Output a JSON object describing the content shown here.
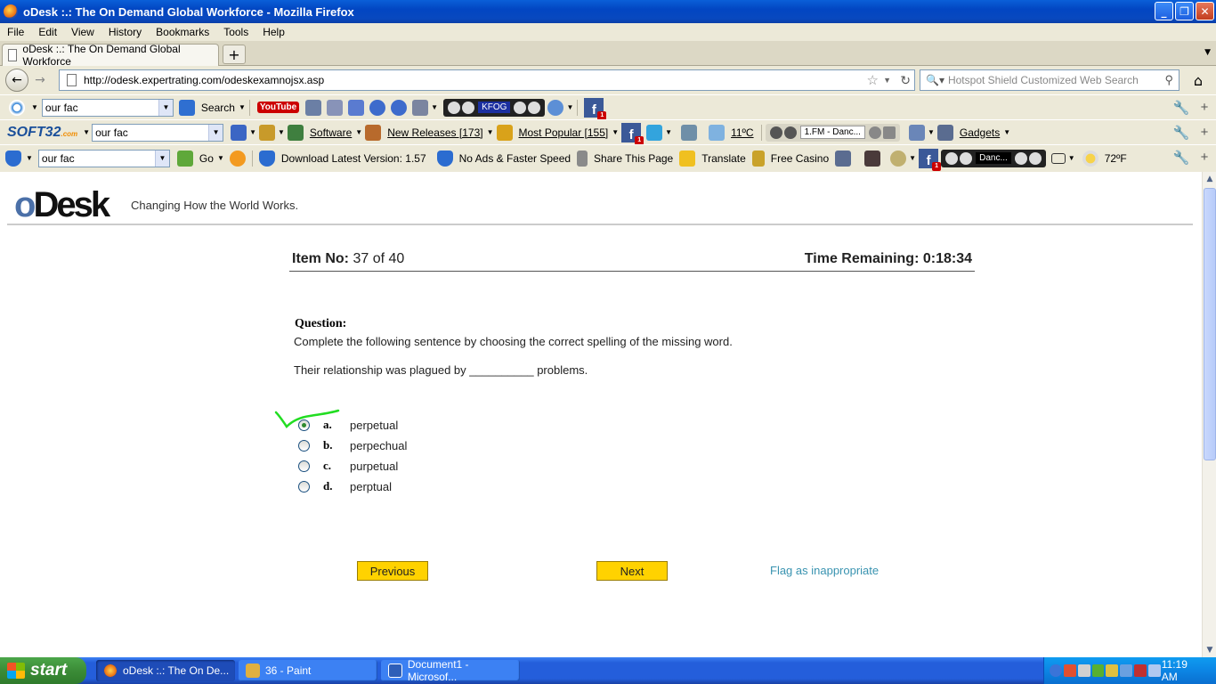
{
  "window": {
    "title": "oDesk :.: The On Demand Global Workforce - Mozilla Firefox"
  },
  "menu": [
    "File",
    "Edit",
    "View",
    "History",
    "Bookmarks",
    "Tools",
    "Help"
  ],
  "tab": {
    "title": "oDesk :.: The On Demand Global Workforce"
  },
  "nav": {
    "url": "http://odesk.expertrating.com/odeskexamnojsx.asp",
    "search_placeholder": "Hotspot Shield Customized Web Search"
  },
  "toolbar1": {
    "search_value": "our fac",
    "search_label": "Search",
    "youtube_label": "YouTube",
    "radio_station": "KFOG"
  },
  "toolbar2": {
    "brand": "SOFT32",
    "brand_suffix": ".com",
    "search_value": "our fac",
    "software": "Software",
    "new_releases": "New Releases [173]",
    "most_popular": "Most Popular [155]",
    "weather": "11ºC",
    "radio": "1.FM - Danc...",
    "gadgets": "Gadgets"
  },
  "toolbar3": {
    "search_value": "our fac",
    "go_label": "Go",
    "download": "Download Latest Version: 1.57",
    "no_ads": "No Ads & Faster Speed",
    "share": "Share This Page",
    "translate": "Translate",
    "casino": "Free Casino",
    "radio": "Danc...",
    "weather": "72ºF"
  },
  "page": {
    "logo_o": "o",
    "logo_rest": "Desk",
    "tagline": "Changing How the World Works.",
    "item_label": "Item No:",
    "item_value": "37 of 40",
    "time_remaining": "Time Remaining: 0:18:34",
    "question_label": "Question:",
    "question_text": "Complete the following sentence by choosing the correct spelling of the missing word.",
    "sentence": "Their relationship was plagued by __________ problems.",
    "options": [
      {
        "letter": "a.",
        "text": "perpetual",
        "selected": true
      },
      {
        "letter": "b.",
        "text": "perpechual",
        "selected": false
      },
      {
        "letter": "c.",
        "text": "purpetual",
        "selected": false
      },
      {
        "letter": "d.",
        "text": "perptual",
        "selected": false
      }
    ],
    "previous": "Previous",
    "next": "Next",
    "flag": "Flag as inappropriate"
  },
  "taskbar": {
    "start": "start",
    "tasks": [
      "oDesk :.: The On De...",
      "36 - Paint",
      "Document1 - Microsof..."
    ],
    "clock": "11:19 AM"
  },
  "colors": {
    "accent_yellow": "#ffd200",
    "flag_link": "#3993b0",
    "check_green": "#22dd22"
  }
}
